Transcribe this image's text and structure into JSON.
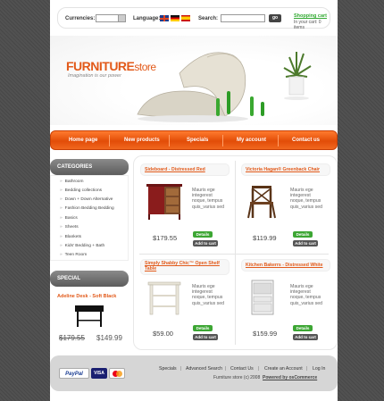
{
  "topbar": {
    "currencies_label": "Currencies:",
    "language_label": "Language:",
    "search_label": "Search:",
    "search_button": "go",
    "cart_title": "Shopping cart",
    "cart_status": "In your cart: 0 items"
  },
  "header": {
    "logo_main": "FURNITURE",
    "logo_store": "store",
    "slogan": "Imagination is our power"
  },
  "nav": [
    "Home page",
    "New products",
    "Specials",
    "My account",
    "Contact us"
  ],
  "categories": {
    "title": "CATEGORIES",
    "items": [
      "Bathroom",
      "Bedding collections",
      "Down + Down Alternative",
      "Fashion Bedding Bedding",
      "Basics",
      "Sheets",
      "Blankets",
      "Kids' Bedding + Bath",
      "Teen Room"
    ]
  },
  "special": {
    "title": "SPECIAL",
    "product_name": "Adeline Desk - Soft Black",
    "old_price": "$179.55",
    "new_price": "$149.99"
  },
  "products": [
    {
      "title": "Sideboard - Distressed Red",
      "desc": "Mauris ege\nintegerest\nnoque, tempus\nquis_varius sed",
      "price": "$179.55",
      "details": "Details",
      "add_to_cart": "Add to cart"
    },
    {
      "title": "Victoria Hagan® Greenback Chair",
      "desc": "Mauris ege\nintegerest\nnoque, tempus\nquis_varius sed",
      "price": "$119.99",
      "details": "Details",
      "add_to_cart": "Add to cart"
    },
    {
      "title": "Simply Shabby Chic™ Open Shelf Table",
      "desc": "Mauris ege\nintegerest\nnoque, tempus\nquis_varius sed",
      "price": "$59.00",
      "details": "Details",
      "add_to_cart": "Add to cart"
    },
    {
      "title": "Kitchen Bakerrs - Distressed White",
      "desc": "Mauris ege\nintegerest\nnoque, tempus\nquis_varius sed",
      "price": "$159.99",
      "details": "Details",
      "add_to_cart": "Add to cart"
    }
  ],
  "footer": {
    "payment_paypal": "PayPal",
    "payment_visa": "VISA",
    "links": [
      "Specials",
      "Advanced Search",
      "Contact Us",
      "Create an Account",
      "Log In"
    ],
    "copyright": "Furniture store (c) 2008",
    "powered_by": "Powered by osCommerce"
  },
  "colors": {
    "accent": "#e25a1a",
    "nav_orange": "#f1681f",
    "button_green": "#3ca633"
  }
}
